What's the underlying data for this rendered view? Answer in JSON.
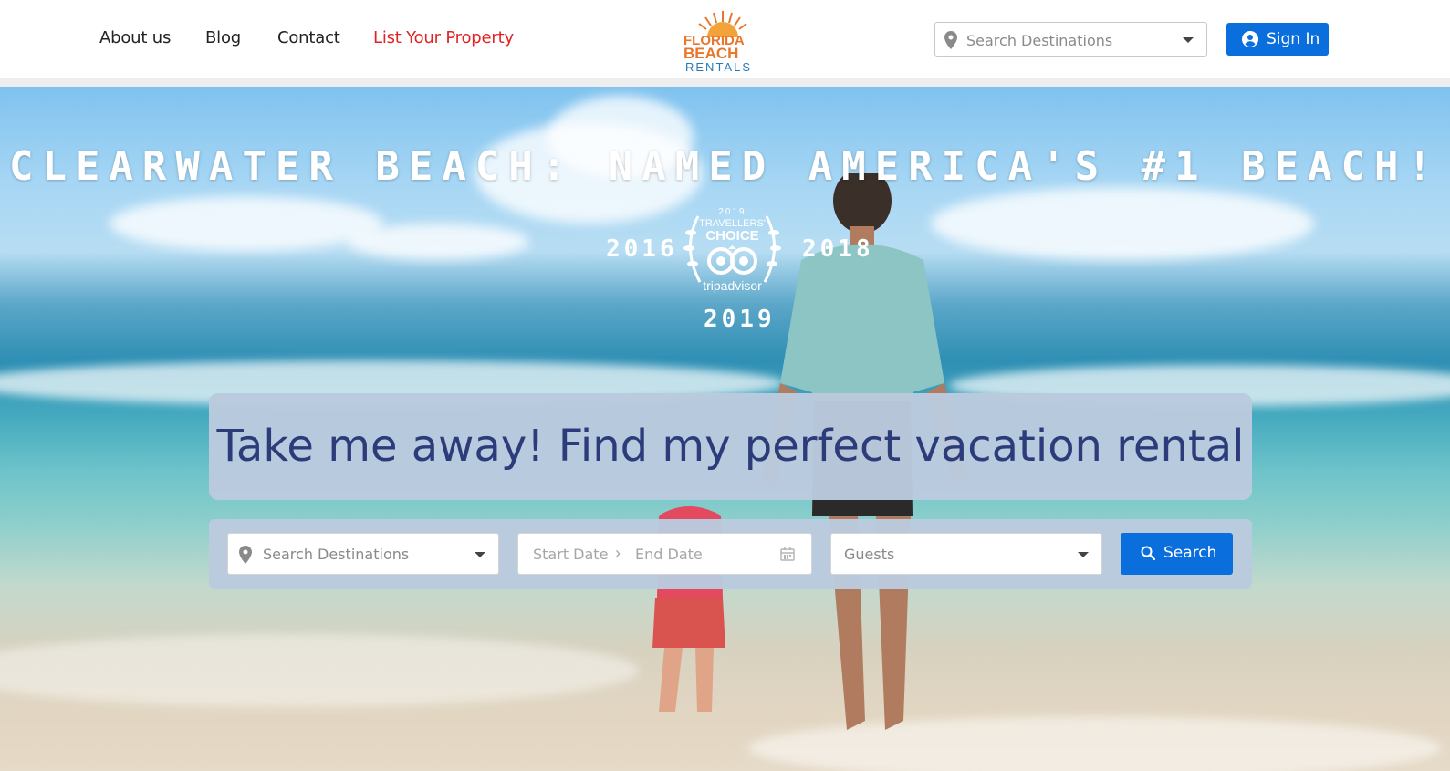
{
  "nav": {
    "about": "About us",
    "blog": "Blog",
    "contact": "Contact",
    "list_property": "List Your Property",
    "list_property_color": "#e02424"
  },
  "logo": {
    "line1": "FLORIDA",
    "line2": "BEACH",
    "line3": "RENTALS"
  },
  "header_search": {
    "placeholder": "Search Destinations"
  },
  "signin": {
    "label": "Sign In"
  },
  "hero": {
    "headline": "CLEARWATER BEACH: NAMED AMERICA'S #1 BEACH!",
    "years": [
      "2016",
      "2018",
      "2019"
    ],
    "badge": {
      "year": "2019",
      "line1": "TRAVELLERS'",
      "line2": "CHOICE",
      "brand": "tripadvisor"
    },
    "tagline": "Take me away! Find my perfect vacation rental"
  },
  "search_panel": {
    "destination_placeholder": "Search Destinations",
    "start_date": "Start Date",
    "end_date": "End Date",
    "guests_placeholder": "Guests",
    "button": "Search"
  },
  "colors": {
    "primary": "#0a6fdc",
    "tagline": "#2c3c7a",
    "logo_orange": "#e8762b",
    "logo_blue": "#2a79b7"
  },
  "icons": {
    "location": "map-pin-icon",
    "user": "user-circle-icon",
    "calendar": "calendar-icon",
    "search": "magnifier-icon",
    "caret": "chevron-down-icon"
  }
}
